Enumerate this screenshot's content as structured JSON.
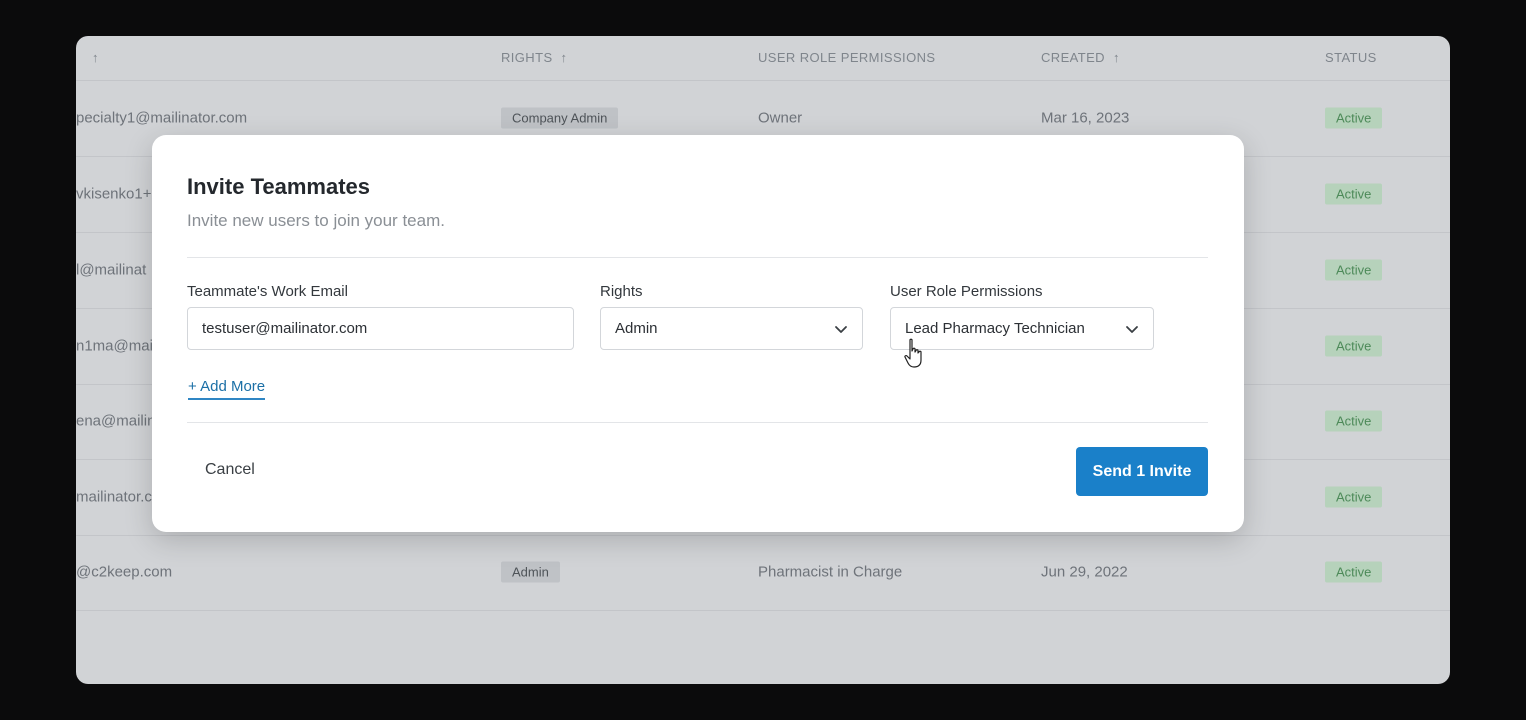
{
  "table": {
    "headers": {
      "email": "",
      "rights": "RIGHTS",
      "user_role_permissions": "USER ROLE PERMISSIONS",
      "created": "CREATED",
      "status": "STATUS"
    },
    "rows": [
      {
        "email": "pecialty1@mailinator.com",
        "rights": "Company Admin",
        "role": "Owner",
        "created": "Mar 16, 2023",
        "status": "Active"
      },
      {
        "email": "vkisenko1+",
        "rights": "",
        "role": "",
        "created": "",
        "status": "Active"
      },
      {
        "email": "l@mailinat",
        "rights": "",
        "role": "",
        "created": "",
        "status": "Active"
      },
      {
        "email": "n1ma@mail",
        "rights": "",
        "role": "",
        "created": "",
        "status": "Active"
      },
      {
        "email": "ena@mailin",
        "rights": "",
        "role": "",
        "created": "",
        "status": "Active"
      },
      {
        "email": "mailinator.c",
        "rights": "",
        "role": "",
        "created": "",
        "status": "Active"
      },
      {
        "email": "@c2keep.com",
        "rights": "Admin",
        "role": "Pharmacist in Charge",
        "created": "Jun 29, 2022",
        "status": "Active"
      }
    ]
  },
  "modal": {
    "title": "Invite Teammates",
    "subtitle": "Invite new users to join your team.",
    "email_label": "Teammate's Work Email",
    "email_value": "testuser@mailinator.com",
    "rights_label": "Rights",
    "rights_value": "Admin",
    "role_label": "User Role Permissions",
    "role_value": "Lead Pharmacy Technician",
    "add_more": "+ Add More",
    "cancel": "Cancel",
    "send": "Send 1 Invite"
  },
  "colors": {
    "primary": "#1a80c9",
    "status_bg": "#b6d2bb",
    "status_text": "#4d8a59"
  },
  "icons": [
    "sort-arrow-icon",
    "chevron-down-icon",
    "hand-cursor-icon"
  ]
}
